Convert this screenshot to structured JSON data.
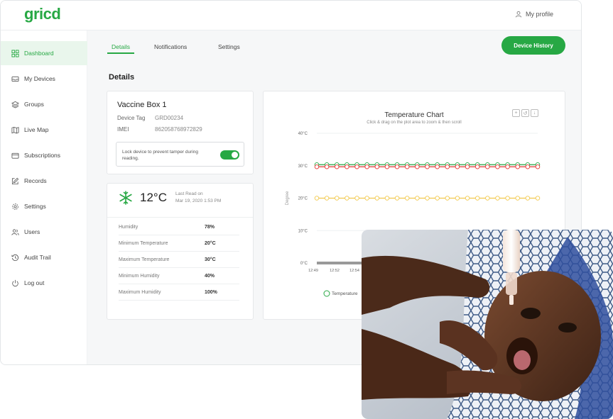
{
  "app": {
    "logo": "gricd",
    "profile_label": "My profile"
  },
  "sidebar": {
    "items": [
      {
        "label": "Dashboard",
        "icon": "dashboard-icon"
      },
      {
        "label": "My Devices",
        "icon": "devices-icon"
      },
      {
        "label": "Groups",
        "icon": "groups-icon"
      },
      {
        "label": "Live Map",
        "icon": "map-icon"
      },
      {
        "label": "Subscriptions",
        "icon": "subscriptions-icon"
      },
      {
        "label": "Records",
        "icon": "records-icon"
      },
      {
        "label": "Settings",
        "icon": "settings-icon"
      },
      {
        "label": "Users",
        "icon": "users-icon"
      },
      {
        "label": "Audit Trail",
        "icon": "audit-trail-icon"
      },
      {
        "label": "Log out",
        "icon": "logout-icon"
      }
    ],
    "active_index": 0
  },
  "tabs": [
    {
      "label": "Details",
      "active": true
    },
    {
      "label": "Notifications",
      "active": false
    },
    {
      "label": "Settings",
      "active": false
    }
  ],
  "actions": {
    "device_history": "Device History"
  },
  "details": {
    "section_title": "Details",
    "device_name": "Vaccine Box 1",
    "device_tag_label": "Device Tag",
    "device_tag": "GRD00234",
    "imei_label": "IMEI",
    "imei": "862058768972829",
    "lock_text": "Lock device to prevent tamper during reading.",
    "lock_enabled": true
  },
  "reading": {
    "temperature": "12°C",
    "last_read_label": "Last Read on",
    "last_read_time": "Mar 19, 2020 1:53 PM",
    "stats": [
      {
        "label": "Humidity",
        "value": "78%"
      },
      {
        "label": "Minimum Temperature",
        "value": "20°C"
      },
      {
        "label": "Maximum Temperature",
        "value": "30°C"
      },
      {
        "label": "Minimum Humidity",
        "value": "40%"
      },
      {
        "label": "Maximum Humidity",
        "value": "100%"
      }
    ]
  },
  "colors": {
    "accent": "#27a844",
    "accent_light": "#e9f6ec",
    "max_line": "#e53935",
    "min_line": "#f2c94c"
  },
  "chart_data": {
    "type": "line",
    "title": "Temperature Chart",
    "subtitle": "Click & drag on the plot area to zoom & then scroll",
    "ylabel": "Degree",
    "yticks": [
      "40°C",
      "30°C",
      "20°C",
      "10°C",
      "0°C"
    ],
    "ylim": [
      0,
      40
    ],
    "xticks": [
      "12:49",
      "12:52",
      "12:54"
    ],
    "series": [
      {
        "name": "Temperature",
        "values": [
          30,
          30,
          30,
          30,
          30,
          30,
          30,
          30,
          30,
          30,
          30,
          30,
          30,
          30,
          30,
          30,
          30,
          30,
          30,
          30,
          30,
          30,
          30
        ]
      },
      {
        "values": [
          30,
          30,
          30,
          30,
          30,
          30,
          30,
          30,
          30,
          30,
          30,
          30,
          30,
          30,
          30,
          30,
          30,
          30,
          30,
          30,
          30,
          30,
          30
        ]
      },
      {
        "values": [
          20,
          20,
          20,
          20,
          20,
          20,
          20,
          20,
          20,
          20,
          20,
          20,
          20,
          20,
          20,
          20,
          20,
          20,
          20,
          20,
          20,
          20,
          20
        ]
      }
    ],
    "grid": true,
    "legend_position": "bottom"
  }
}
